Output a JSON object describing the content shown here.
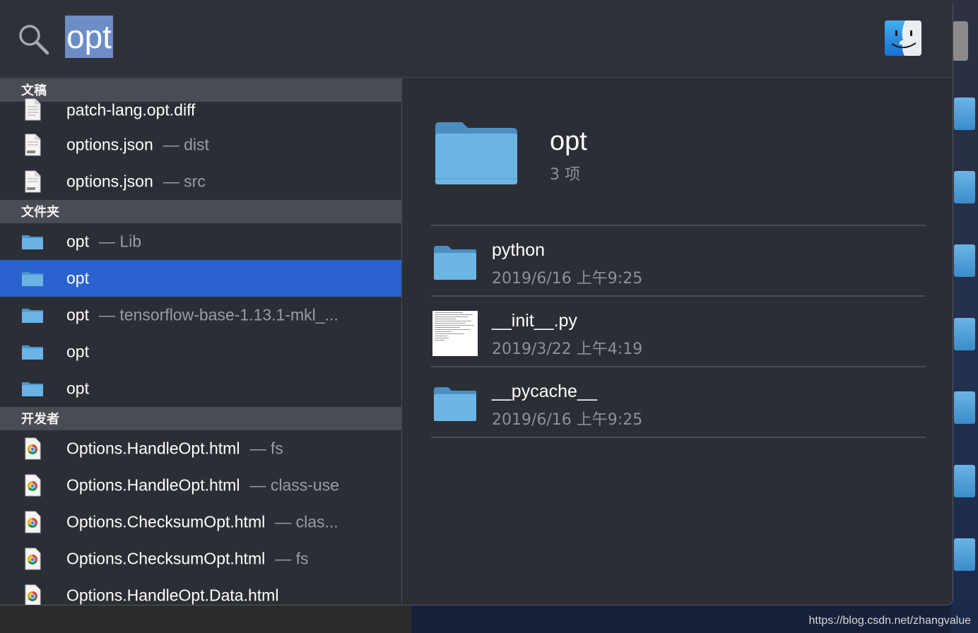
{
  "search": {
    "query": "opt"
  },
  "icons": {
    "search": "search-icon",
    "finder": "finder-icon",
    "document": "document-icon",
    "folder": "folder-icon",
    "chrome_html": "chrome-html-icon"
  },
  "colors": {
    "selection": "#2a63cf",
    "search_highlight": "#6d8ec4",
    "section_header": "#4a4c53",
    "folder_blue": "#5fa8dc"
  },
  "results": {
    "sections": [
      {
        "title": "文稿",
        "items": [
          {
            "name": "patch-lang.opt.diff",
            "sub": "",
            "icon": "document"
          },
          {
            "name": "options.json",
            "sub": "— dist",
            "icon": "document"
          },
          {
            "name": "options.json",
            "sub": "— src",
            "icon": "document"
          }
        ]
      },
      {
        "title": "文件夹",
        "items": [
          {
            "name": "opt",
            "sub": "— Lib",
            "icon": "folder"
          },
          {
            "name": "opt",
            "sub": "",
            "icon": "folder",
            "selected": true
          },
          {
            "name": "opt",
            "sub": "— tensorflow-base-1.13.1-mkl_...",
            "icon": "folder"
          },
          {
            "name": "opt",
            "sub": "",
            "icon": "folder"
          },
          {
            "name": "opt",
            "sub": "",
            "icon": "folder"
          }
        ]
      },
      {
        "title": "开发者",
        "items": [
          {
            "name": "Options.HandleOpt.html",
            "sub": "— fs",
            "icon": "chrome_html"
          },
          {
            "name": "Options.HandleOpt.html",
            "sub": "— class-use",
            "icon": "chrome_html"
          },
          {
            "name": "Options.ChecksumOpt.html",
            "sub": "— clas...",
            "icon": "chrome_html"
          },
          {
            "name": "Options.ChecksumOpt.html",
            "sub": "— fs",
            "icon": "chrome_html"
          },
          {
            "name": "Options.HandleOpt.Data.html",
            "sub": "",
            "icon": "chrome_html"
          }
        ]
      }
    ]
  },
  "preview": {
    "title": "opt",
    "count": "3 项",
    "items": [
      {
        "name": "python",
        "date": "2019/6/16 上午9:25",
        "icon": "folder"
      },
      {
        "name": "__init__.py",
        "date": "2019/3/22 上午4:19",
        "icon": "python-file-thumbnail"
      },
      {
        "name": "__pycache__",
        "date": "2019/6/16 上午9:25",
        "icon": "folder"
      }
    ]
  },
  "watermark": "https://blog.csdn.net/zhangvalue"
}
